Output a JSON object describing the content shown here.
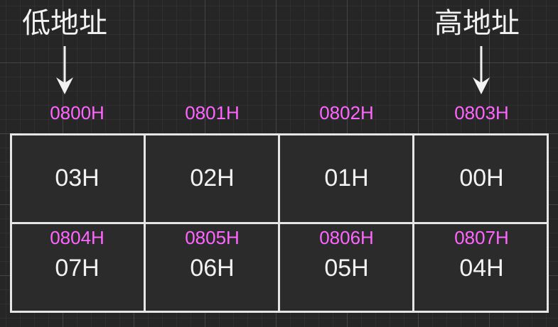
{
  "labels": {
    "low_address": "低地址",
    "high_address": "高地址"
  },
  "memory": {
    "row1": [
      {
        "address": "0800H",
        "value": "03H"
      },
      {
        "address": "0801H",
        "value": "02H"
      },
      {
        "address": "0802H",
        "value": "01H"
      },
      {
        "address": "0803H",
        "value": "00H"
      }
    ],
    "row2": [
      {
        "address": "0804H",
        "value": "07H"
      },
      {
        "address": "0805H",
        "value": "06H"
      },
      {
        "address": "0806H",
        "value": "05H"
      },
      {
        "address": "0807H",
        "value": "04H"
      }
    ]
  },
  "colors": {
    "address_text": "#ff66ff",
    "value_text": "#f2f2f2",
    "border": "#e6e6e6",
    "background": "#262626"
  }
}
